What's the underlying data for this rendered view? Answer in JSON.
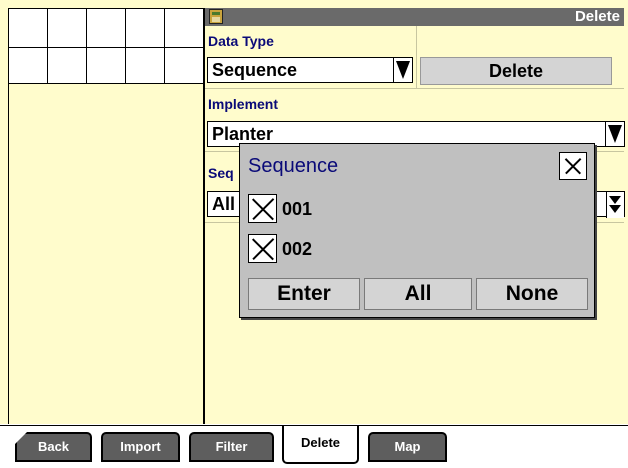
{
  "header": {
    "app_icon": "field-app-icon",
    "title": "Delete"
  },
  "form": {
    "data_type_label": "Data Type",
    "data_type_value": "Sequence",
    "delete_button_label": "Delete",
    "implement_label": "Implement",
    "implement_value": "Planter",
    "sequence_label_partial": "Seq",
    "sequence_value_partial": "All"
  },
  "modal": {
    "title": "Sequence",
    "items": [
      {
        "label": "001",
        "checked": true
      },
      {
        "label": "002",
        "checked": true
      }
    ],
    "buttons": {
      "enter": "Enter",
      "all": "All",
      "none": "None"
    }
  },
  "tabs": {
    "back": "Back",
    "import": "Import",
    "filter": "Filter",
    "delete": "Delete",
    "map": "Map",
    "active": "Delete"
  },
  "colors": {
    "panel_background": "#fffccc",
    "title_bar": "#6a6a6a",
    "label_text": "#0a0a78",
    "modal_background": "#c0c0c0",
    "tab_background": "#5e5e5e"
  }
}
